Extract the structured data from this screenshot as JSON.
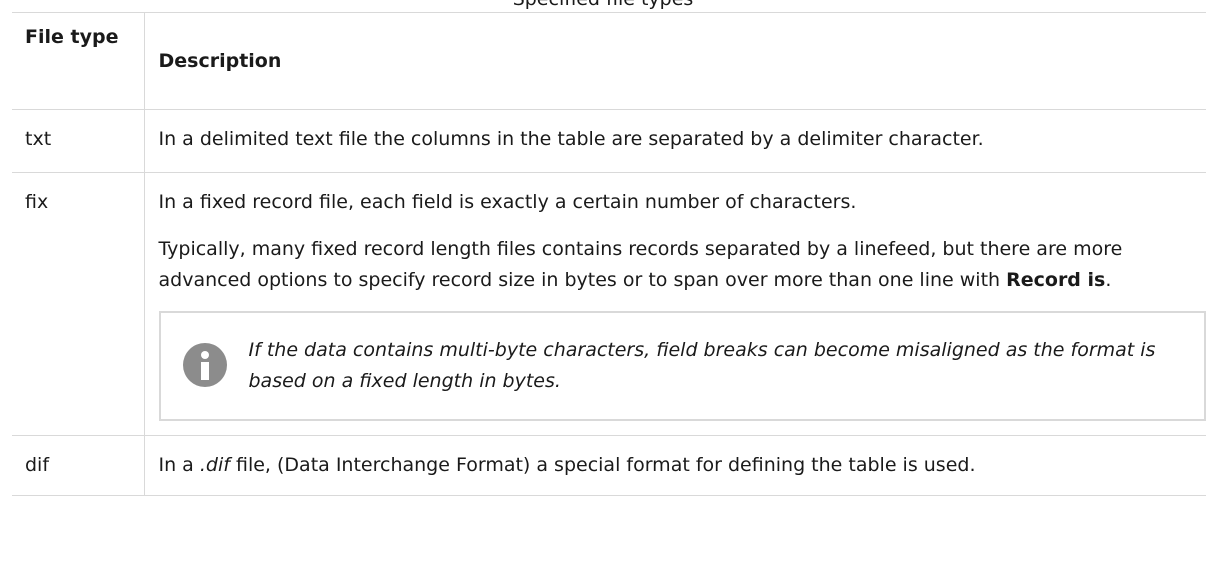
{
  "caption": "Specified file types",
  "table": {
    "headers": {
      "file_type": "File type",
      "description": "Description"
    },
    "rows": [
      {
        "type": "txt",
        "description": "In a delimited text file the columns in the table are separated by a delimiter character."
      },
      {
        "type": "fix",
        "para1": "In a fixed record file, each field is exactly a certain number of characters.",
        "para2_before": "Typically, many fixed record length files contains records separated by a linefeed, but there are more advanced options to specify record size in bytes or to span over more than one line with ",
        "para2_bold": "Record is",
        "para2_after": ".",
        "note": "If the data contains multi-byte characters, field breaks can become misaligned as the format is based on a fixed length in bytes.",
        "note_icon": "info-icon"
      },
      {
        "type": "dif",
        "desc_before": "In a ",
        "desc_italic": ".dif",
        "desc_after": " file, (Data Interchange Format) a special format for defining the table is used."
      }
    ]
  }
}
